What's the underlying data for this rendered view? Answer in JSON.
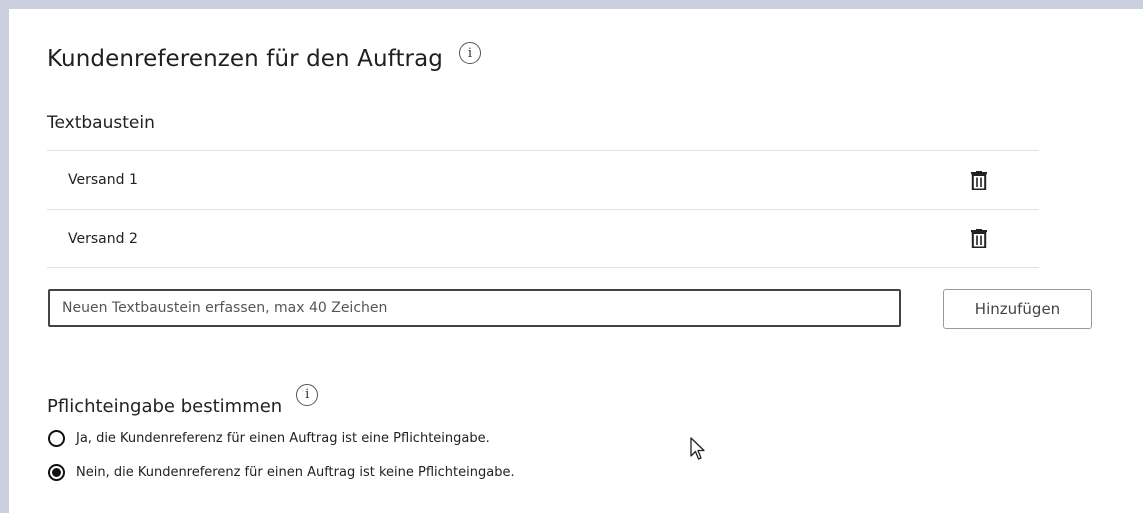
{
  "section": {
    "title": "Kundenreferenzen für den Auftrag",
    "info_glyph": "i"
  },
  "textbaustein": {
    "label": "Textbaustein",
    "items": [
      {
        "label": "Versand 1",
        "icon": "trash-icon"
      },
      {
        "label": "Versand 2",
        "icon": "trash-icon"
      }
    ],
    "input": {
      "value": "",
      "placeholder": "Neuen Textbaustein erfassen, max 40 Zeichen"
    },
    "add_button_label": "Hinzufügen"
  },
  "pflicht": {
    "label": "Pflichteingabe bestimmen",
    "info_glyph": "i",
    "options": [
      {
        "label": "Ja, die Kundenreferenz für einen Auftrag ist eine Pflichteingabe.",
        "selected": false
      },
      {
        "label": "Nein, die Kundenreferenz für einen Auftrag ist keine Pflichteingabe.",
        "selected": true
      }
    ]
  },
  "colors": {
    "frame": "#c9cfdd",
    "panel": "#ffffff",
    "divider": "#e2e2e2"
  }
}
